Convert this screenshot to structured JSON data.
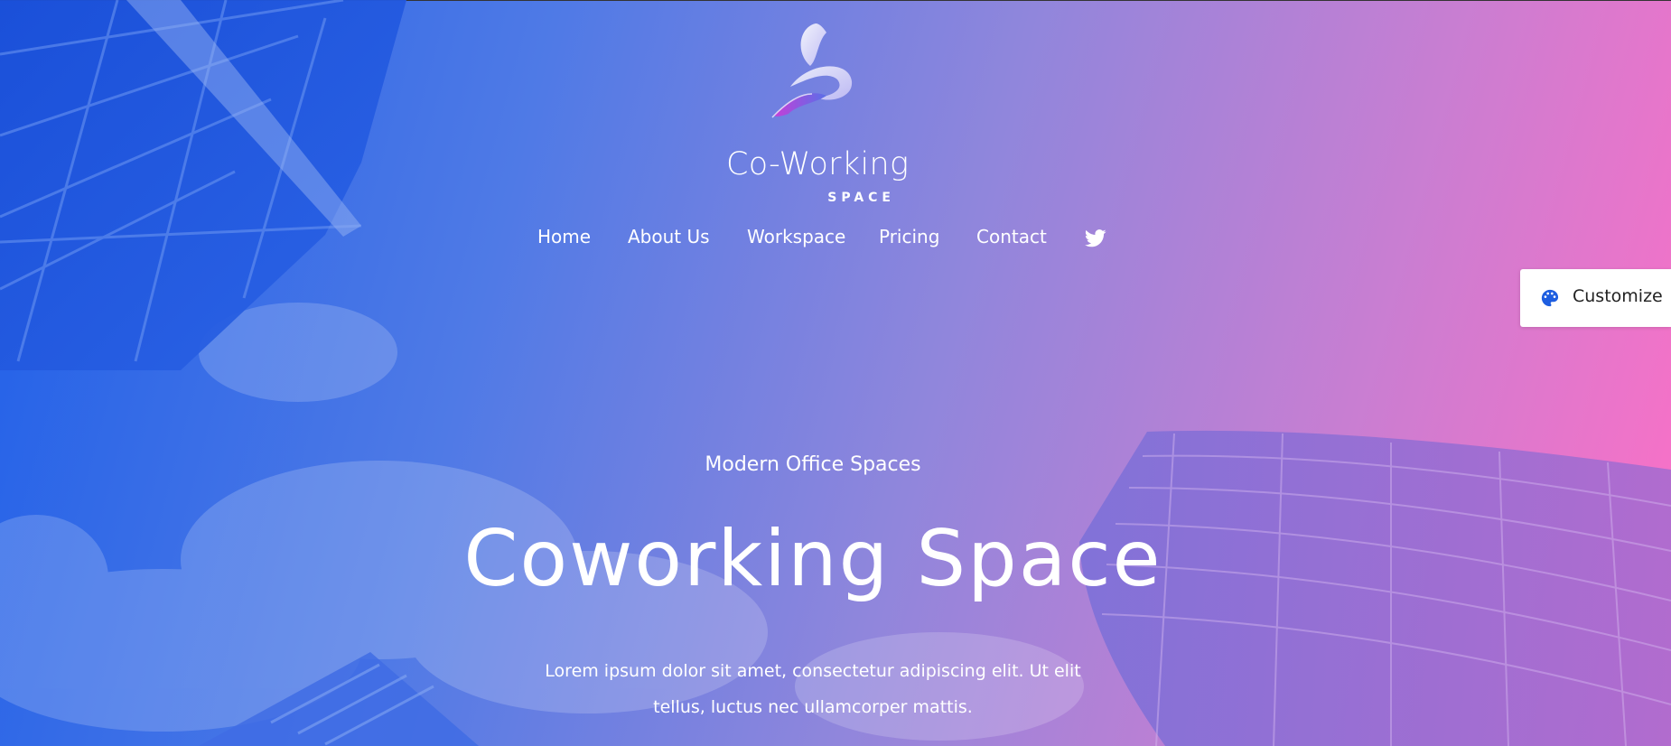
{
  "brand": {
    "title": "Co-Working",
    "subtitle": "SPACE",
    "logo_icon": "swirl-logo-icon"
  },
  "nav": {
    "items": [
      {
        "label": "Home"
      },
      {
        "label": "About Us"
      },
      {
        "label": "Workspace"
      },
      {
        "label": "Pricing"
      },
      {
        "label": "Contact"
      }
    ],
    "social_icon": "twitter-icon"
  },
  "customize": {
    "label": "Customize",
    "icon": "palette-icon",
    "icon_color": "#1e5ee0"
  },
  "hero": {
    "eyebrow": "Modern Office Spaces",
    "headline": "Coworking Space",
    "lead": "Lorem ipsum dolor sit amet, consectetur adipiscing elit. Ut elit tellus, luctus nec ullamcorper mattis."
  },
  "colors": {
    "gradient_start": "#1f5fe8",
    "gradient_end": "#ff6fc5",
    "text": "#ffffff"
  }
}
